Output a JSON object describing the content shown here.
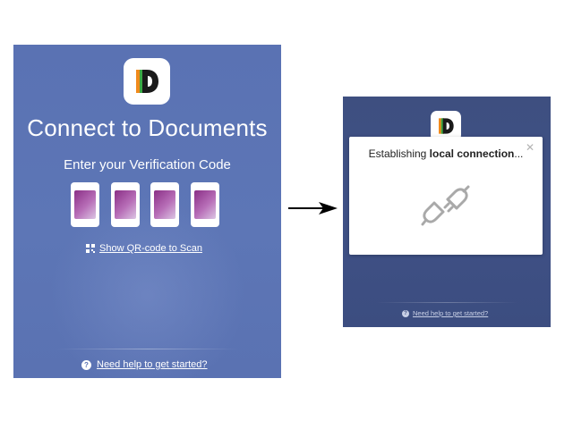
{
  "left_screen": {
    "title": "Connect to Documents",
    "subtitle": "Enter your Verification Code",
    "code_boxes_count": 4,
    "qr_link": {
      "icon": "qr-code-icon",
      "label": "Show QR-code to Scan"
    },
    "help_link": {
      "icon": "help-circle-icon",
      "label": "Need help to get started?"
    }
  },
  "transition": {
    "icon": "arrow-right-icon"
  },
  "right_screen": {
    "dialog": {
      "title_prefix": "Establishing ",
      "title_bold": "local connection",
      "title_suffix": "...",
      "close_icon": "close-icon",
      "icon": "plug-disconnected-icon"
    },
    "help_link": {
      "icon": "help-circle-icon",
      "label": "Need help to get started?"
    }
  },
  "colors": {
    "panel_bg": "#5a72b3",
    "panel_bg_dimmed": "#3e4f80",
    "code_gradient_start": "#8a2f86",
    "code_gradient_end": "#dcc6e4",
    "logo_orange": "#f08a1c",
    "logo_green": "#3aa843"
  }
}
